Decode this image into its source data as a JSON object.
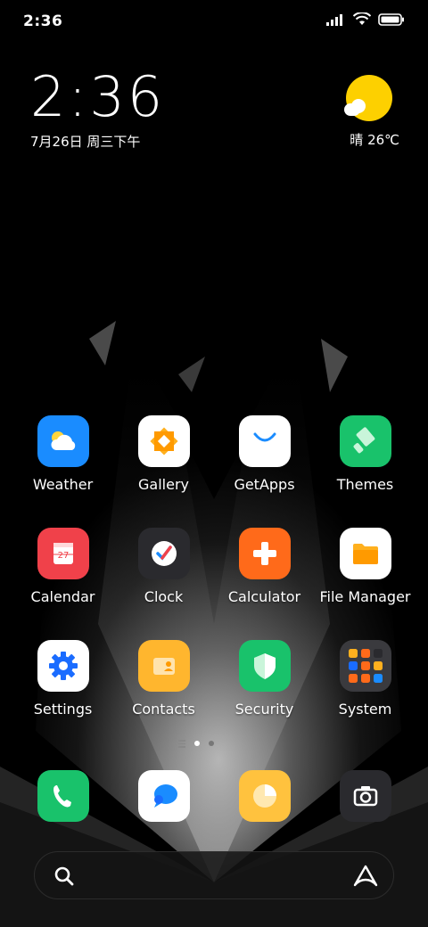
{
  "status_bar": {
    "time": "2:36",
    "icons": [
      "signal-icon",
      "wifi-icon",
      "battery-icon"
    ]
  },
  "clock_widget": {
    "time": "2:36",
    "date": "7月26日 周三下午"
  },
  "weather_widget": {
    "icon": "sun-cloud-icon",
    "text": "晴 26℃"
  },
  "apps": [
    {
      "label": "Weather",
      "icon": "weather-icon",
      "color": "#1a8cff"
    },
    {
      "label": "Gallery",
      "icon": "gallery-icon",
      "color": "#ffffff"
    },
    {
      "label": "GetApps",
      "icon": "getapps-icon",
      "color": "#ffffff"
    },
    {
      "label": "Themes",
      "icon": "themes-icon",
      "color": "#19c26b"
    },
    {
      "label": "Calendar",
      "icon": "calendar-icon",
      "color": "#f0414a"
    },
    {
      "label": "Clock",
      "icon": "clock-icon",
      "color": "#2a2a2e"
    },
    {
      "label": "Calculator",
      "icon": "calculator-icon",
      "color": "#ff6a1a"
    },
    {
      "label": "File Manager",
      "icon": "folder-icon",
      "color": "#ffffff"
    },
    {
      "label": "Settings",
      "icon": "settings-icon",
      "color": "#ffffff"
    },
    {
      "label": "Contacts",
      "icon": "contacts-icon",
      "color": "#ffb62e"
    },
    {
      "label": "Security",
      "icon": "shield-icon",
      "color": "#19c26b"
    },
    {
      "label": "System",
      "icon": "folder-grid-icon",
      "color": "#3a3a3e"
    }
  ],
  "calendar_day": "27",
  "page_indicator": {
    "pages": 2,
    "active": 1
  },
  "dock": [
    {
      "icon": "phone-icon",
      "color": "#19c26b"
    },
    {
      "icon": "messaging-icon",
      "color": "#ffffff"
    },
    {
      "icon": "browser-icon",
      "color": "#ffc23e"
    },
    {
      "icon": "camera-icon",
      "color": "#2a2a2e"
    }
  ],
  "search": {
    "search_icon": "search-icon",
    "assistant_icon": "assistant-icon"
  }
}
